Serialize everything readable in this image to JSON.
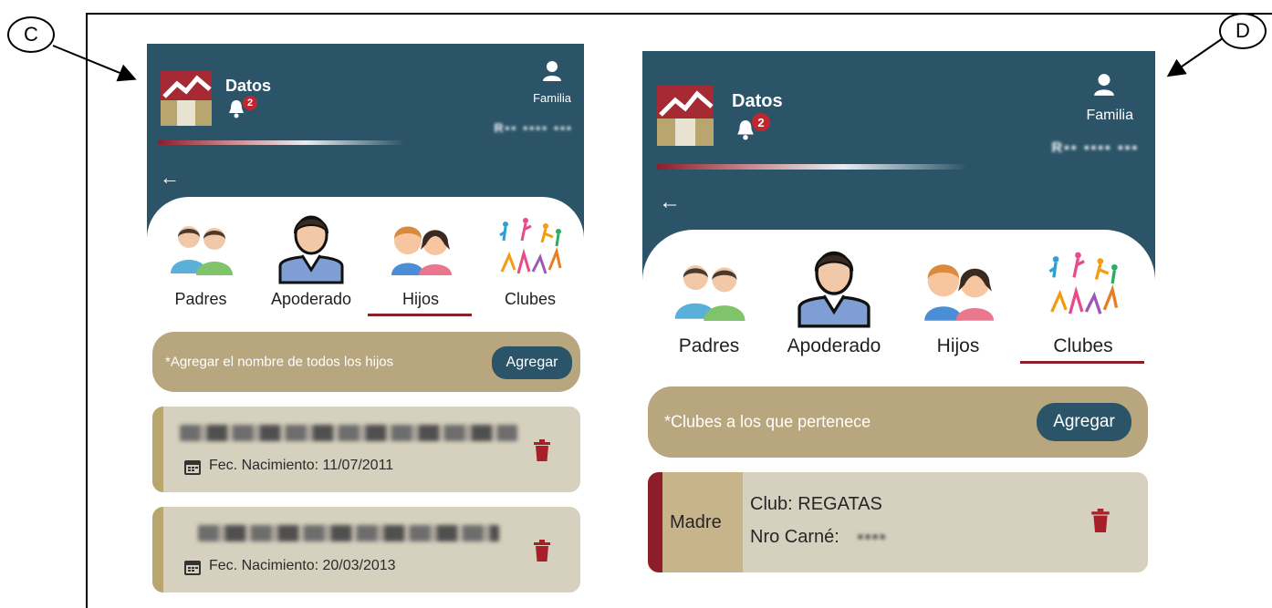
{
  "callouts": {
    "left": "C",
    "right": "D"
  },
  "app": {
    "title": "Datos",
    "notification_count": "2",
    "role": "Familia",
    "username_blurred": "R▪▪ ▪▪▪▪ ▪▪▪",
    "back_icon": "arrow-left-icon",
    "bell_icon": "bell-icon",
    "user_icon": "user-icon",
    "trash_icon": "trash-icon",
    "calendar_icon": "calendar-icon"
  },
  "tabs": [
    {
      "label": "Padres",
      "icon": "parents-icon"
    },
    {
      "label": "Apoderado",
      "icon": "guardian-icon"
    },
    {
      "label": "Hijos",
      "icon": "children-icon"
    },
    {
      "label": "Clubes",
      "icon": "clubs-icon"
    }
  ],
  "screen_c": {
    "active_tab": "Hijos",
    "notice": "*Agregar el nombre de todos los hijos",
    "add_button": "Agregar",
    "children": [
      {
        "dob": "Fec. Nacimiento: 11/07/2011"
      },
      {
        "dob": "Fec. Nacimiento: 20/03/2013"
      }
    ]
  },
  "screen_d": {
    "active_tab": "Clubes",
    "notice": "*Clubes a los que pertenece",
    "add_button": "Agregar",
    "club": {
      "role": "Madre",
      "club": "Club: REGATAS",
      "card_label": "Nro Carné:",
      "card_value": "▪▪▪▪"
    }
  },
  "colors": {
    "header": "#2b5468",
    "accent": "#8e1d2a",
    "pill": "#b8a67e",
    "card": "#d6d0be",
    "button": "#2b5468"
  }
}
